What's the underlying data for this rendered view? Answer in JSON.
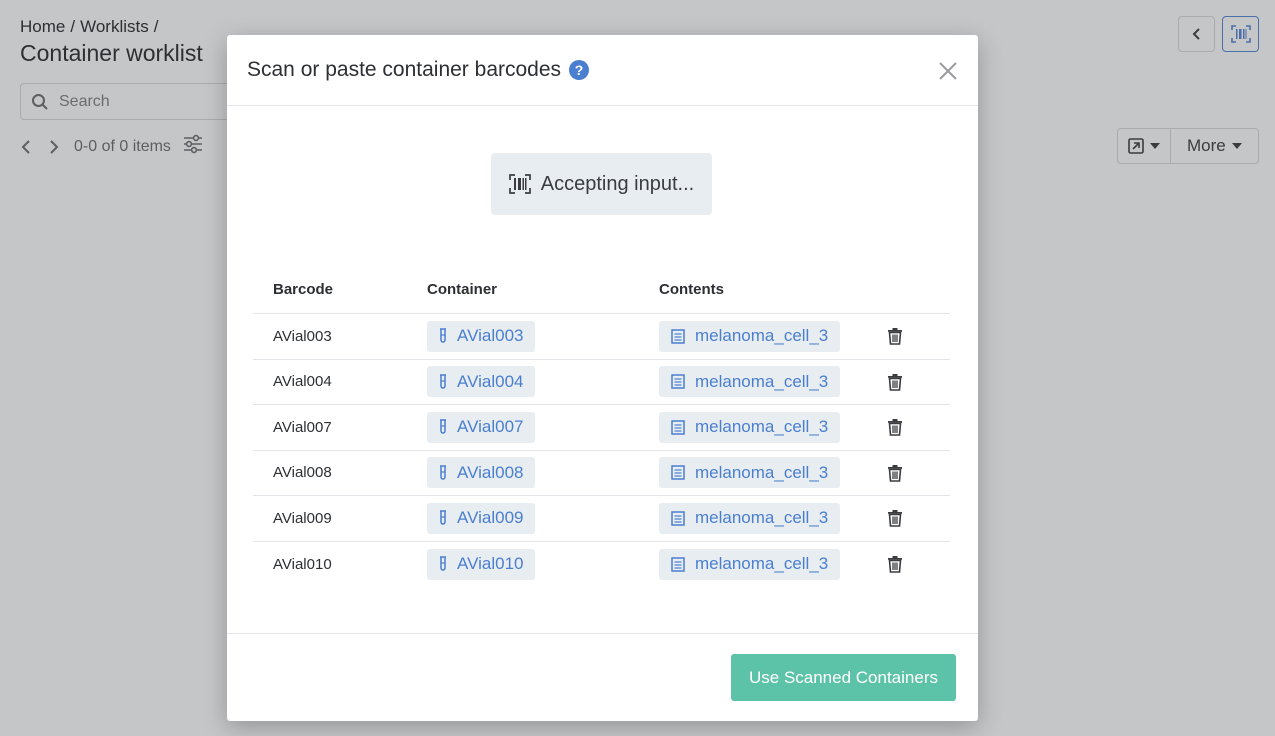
{
  "breadcrumb": {
    "home": "Home",
    "worklists": "Worklists",
    "sep": "/"
  },
  "page": {
    "title": "Container worklist"
  },
  "search": {
    "placeholder": "Search"
  },
  "pager": {
    "range_text": "0-0 of 0 items"
  },
  "toolbar": {
    "more_label": "More"
  },
  "modal": {
    "title": "Scan or paste container barcodes",
    "status": "Accepting input...",
    "columns": {
      "barcode": "Barcode",
      "container": "Container",
      "contents": "Contents"
    },
    "rows": [
      {
        "barcode": "AVial003",
        "container": "AVial003",
        "contents": "melanoma_cell_3"
      },
      {
        "barcode": "AVial004",
        "container": "AVial004",
        "contents": "melanoma_cell_3"
      },
      {
        "barcode": "AVial007",
        "container": "AVial007",
        "contents": "melanoma_cell_3"
      },
      {
        "barcode": "AVial008",
        "container": "AVial008",
        "contents": "melanoma_cell_3"
      },
      {
        "barcode": "AVial009",
        "container": "AVial009",
        "contents": "melanoma_cell_3"
      },
      {
        "barcode": "AVial010",
        "container": "AVial010",
        "contents": "melanoma_cell_3"
      }
    ],
    "primary_button": "Use Scanned Containers"
  },
  "colors": {
    "accent": "#4a7fd0",
    "primary_button": "#5dc3a8",
    "overlay": "#c4c6c8",
    "chip_bg": "#e8edf1"
  },
  "icons": [
    "search-icon",
    "filter-settings-icon",
    "chevron-left-icon",
    "chevron-right-icon",
    "barcode-icon",
    "export-icon",
    "caret-down-icon",
    "help-icon",
    "close-icon",
    "tube-icon",
    "document-icon",
    "trash-icon"
  ]
}
